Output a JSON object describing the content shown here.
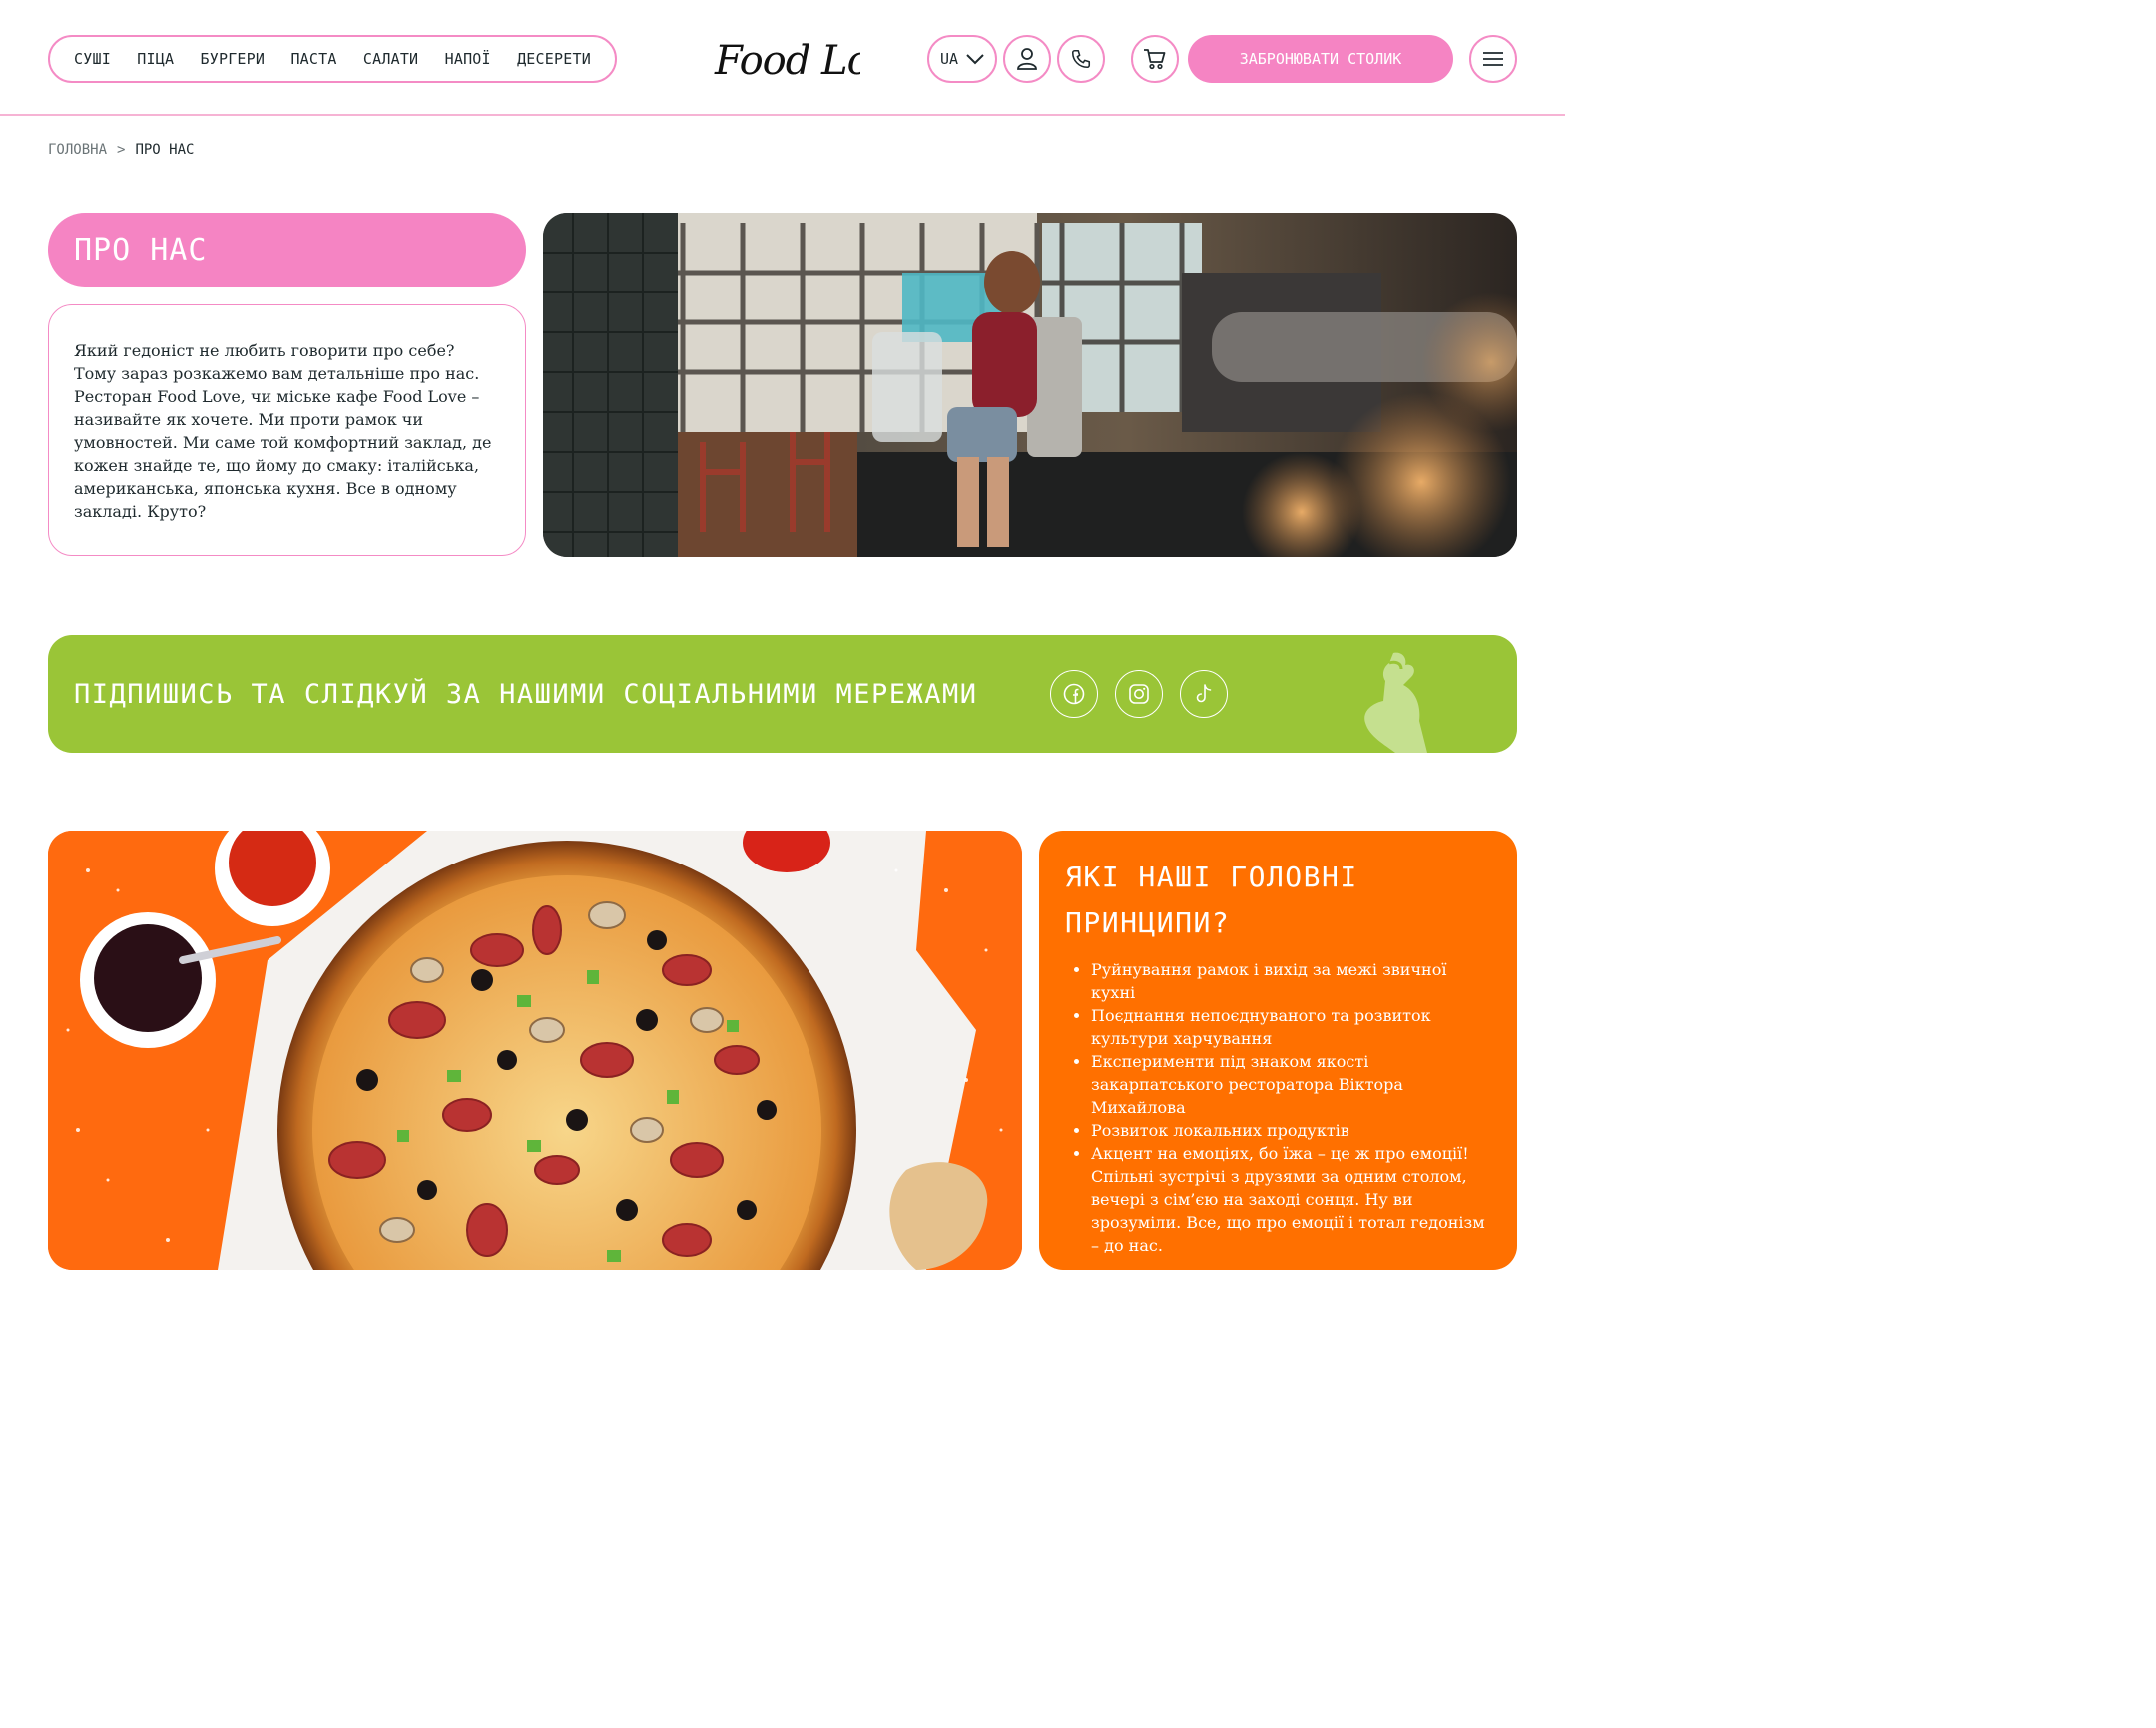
{
  "header": {
    "nav": [
      "СУШІ",
      "ПІЦА",
      "БУРГЕРИ",
      "ПАСТА",
      "САЛАТИ",
      "НАПОЇ",
      "ДЕСЕРЕТИ"
    ],
    "logo_text": "Food Love",
    "lang": "UA",
    "book_label": "ЗАБРОНЮВАТИ СТОЛИК"
  },
  "breadcrumb": {
    "home": "ГОЛОВНА",
    "separator": ">",
    "current": "ПРО НАС"
  },
  "about": {
    "title": "ПРО НАС",
    "text": "Який гедоніст не любить говорити про себе? Тому зараз розкажемо вам детальніше про нас. Ресторан Food Love, чи міське кафе Food Love – називайте як хочете. Ми проти рамок чи умовностей. Ми саме той комфортний заклад, де кожен знайде те, що йому до смаку: італійська, американська, японська кухня. Все в одному закладі. Круто?"
  },
  "social": {
    "text": "ПІДПИШИСЬ ТА СЛІДКУЙ ЗА НАШИМИ СОЦІАЛЬНИМИ МЕРЕЖАМИ",
    "icons": [
      "facebook-icon",
      "instagram-icon",
      "tiktok-icon"
    ]
  },
  "principles": {
    "title": "ЯКІ НАШІ ГОЛОВНІ ПРИНЦИПИ?",
    "items": [
      "Руйнування рамок і вихід за межі звичної кухні",
      "Поєднання непоєднуваного та розвиток культури харчування",
      "Експерименти під знаком якості закарпатського ресторатора Віктора Михайлова",
      "Розвиток локальних продуктів",
      "Акцент на емоціях, бо їжа – це ж про емоції! Спільні зустрічі з друзями за одним столом, вечері з сім’єю на заході сонця. Ну ви зрозуміли. Все, що про емоції і тотал гедонізм – до нас."
    ]
  },
  "colors": {
    "pink": "#f584c3",
    "green": "#9ac537",
    "orange": "#ff7000"
  }
}
